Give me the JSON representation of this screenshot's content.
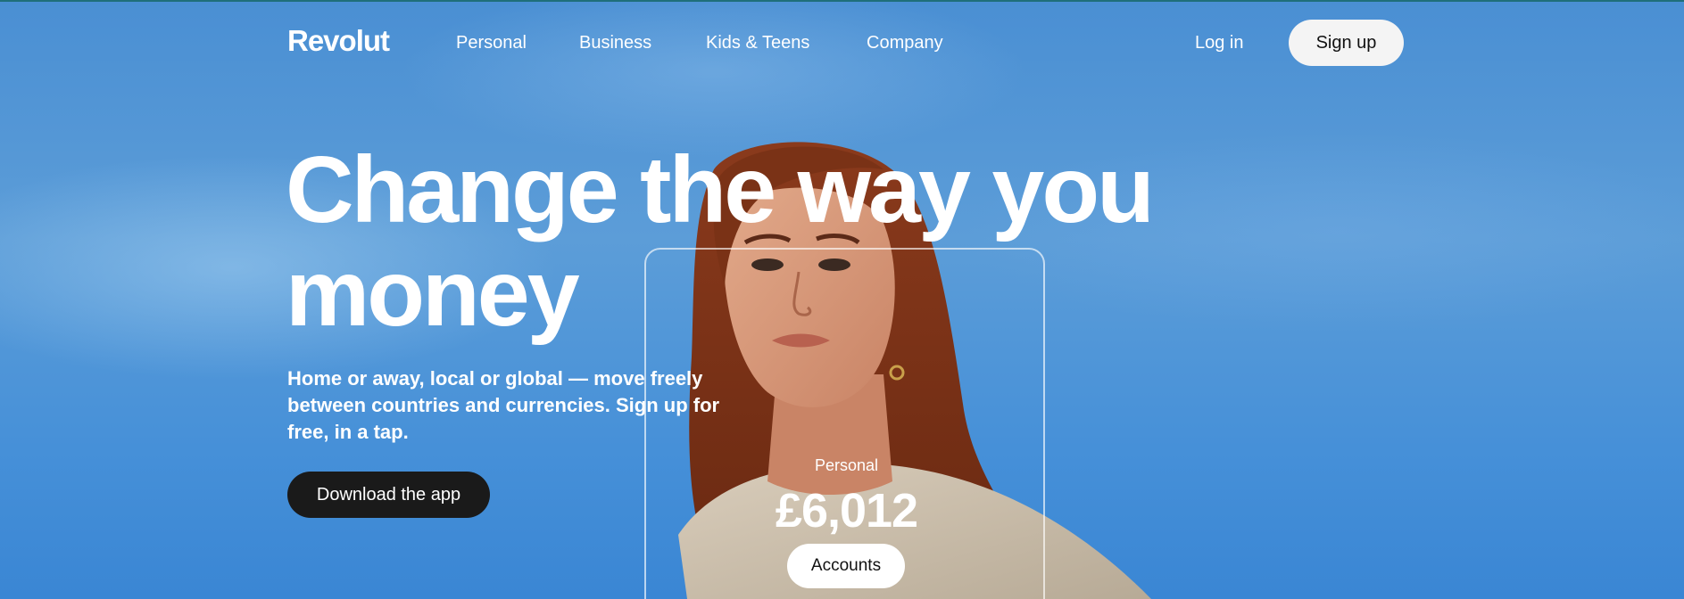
{
  "nav": {
    "logo": "Revolut",
    "links": [
      "Personal",
      "Business",
      "Kids & Teens",
      "Company"
    ],
    "login": "Log in",
    "signup": "Sign up"
  },
  "hero": {
    "headline": "Change the way you money",
    "subtext": "Home or away, local or global — move freely between countries and currencies. Sign up for free, in a tap.",
    "cta": "Download the app"
  },
  "card": {
    "label": "Personal",
    "balance": "£6,012",
    "button": "Accounts"
  },
  "colors": {
    "sky": "#4a8fd3",
    "primary_button": "#1a1a1a",
    "light_button": "#f4f4f4"
  }
}
